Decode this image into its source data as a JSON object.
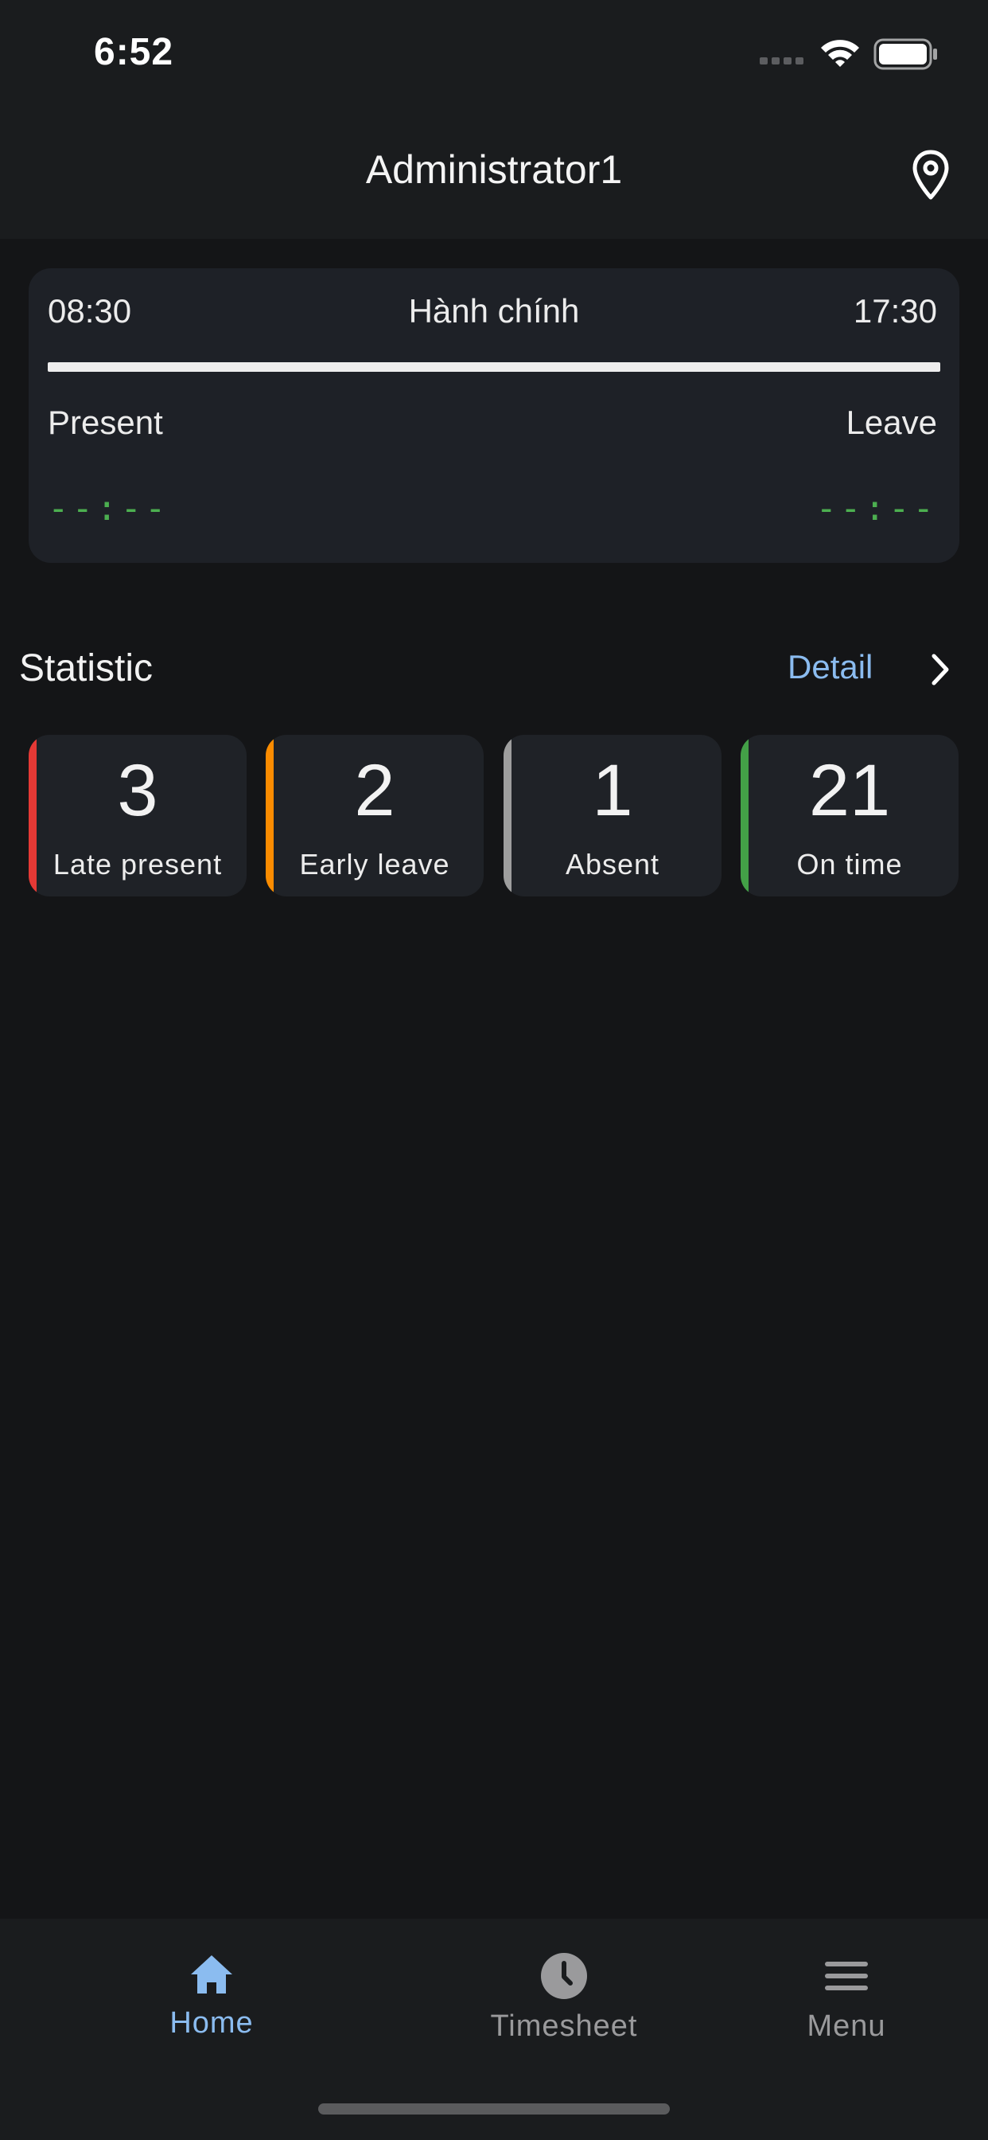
{
  "status_bar": {
    "time": "6:52"
  },
  "header": {
    "title": "Administrator1",
    "location_icon": "map-pin-icon"
  },
  "shift": {
    "start_time": "08:30",
    "name": "Hành chính",
    "end_time": "17:30",
    "present_label": "Present",
    "leave_label": "Leave",
    "present_time": "--:--",
    "leave_time": "--:--",
    "time_color": "#4caf50"
  },
  "statistic": {
    "title": "Statistic",
    "detail_label": "Detail",
    "cards": [
      {
        "value": "3",
        "label": "Late present",
        "color": "#e53935"
      },
      {
        "value": "2",
        "label": "Early leave",
        "color": "#fb8c00"
      },
      {
        "value": "1",
        "label": "Absent",
        "color": "#9e9e9e"
      },
      {
        "value": "21",
        "label": "On time",
        "color": "#43a047"
      }
    ]
  },
  "bottom_nav": {
    "items": [
      {
        "label": "Home",
        "icon": "home-icon",
        "active": true
      },
      {
        "label": "Timesheet",
        "icon": "clock-icon",
        "active": false
      },
      {
        "label": "Menu",
        "icon": "hamburger-menu-icon",
        "active": false
      }
    ],
    "active_color": "#8bbcf0",
    "inactive_color": "#9a9a9c"
  }
}
